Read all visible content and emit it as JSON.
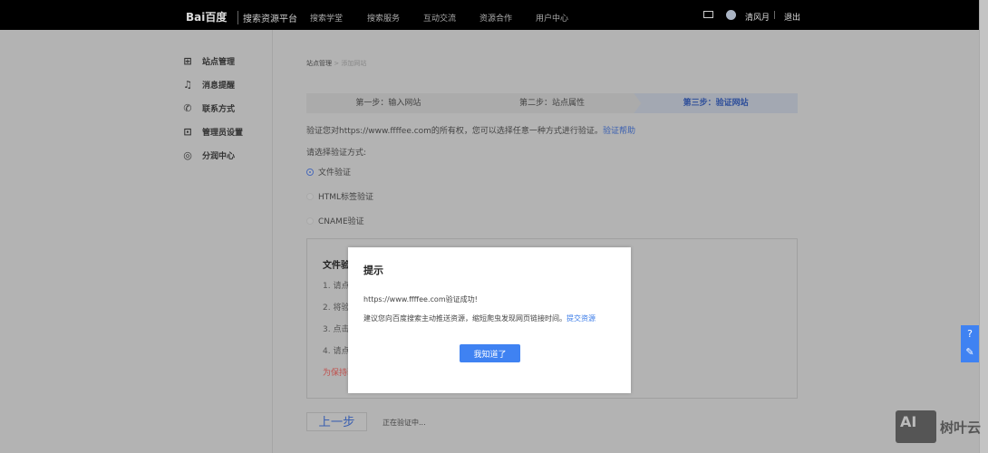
{
  "header": {
    "logo": "Bai百度",
    "platform": "搜索资源平台",
    "nav": [
      "搜索学堂",
      "搜索服务",
      "互动交流",
      "资源合作",
      "用户中心"
    ],
    "username": "清风月",
    "separator": "|",
    "logout": "退出"
  },
  "sidebar": {
    "items": [
      {
        "label": "站点管理",
        "icon": "sitemap-icon"
      },
      {
        "label": "消息提醒",
        "icon": "bell-icon"
      },
      {
        "label": "联系方式",
        "icon": "phone-icon"
      },
      {
        "label": "管理员设置",
        "icon": "admin-icon"
      },
      {
        "label": "分润中心",
        "icon": "revenue-icon"
      }
    ]
  },
  "breadcrumb": {
    "root": "站点管理",
    "sep": ">",
    "current": "添加网站"
  },
  "steps": [
    {
      "label": "第一步：输入网站"
    },
    {
      "label": "第二步：站点属性"
    },
    {
      "label": "第三步：验证网站",
      "active": true
    }
  ],
  "intro": {
    "text": "验证您对https://www.ffffee.com的所有权，您可以选择任意一种方式进行验证。",
    "link": "验证帮助"
  },
  "method_label": "请选择验证方式:",
  "methods": [
    {
      "label": "文件验证",
      "selected": true
    },
    {
      "label": "HTML标签验证",
      "selected": false
    },
    {
      "label": "CNAME验证",
      "selected": false
    }
  ],
  "file_box": {
    "title": "文件验",
    "lines": [
      "1. 请点",
      "2. 将验",
      "3. 点击",
      "4. 请点"
    ],
    "warning": "为保持验"
  },
  "footer": {
    "prev": "上一步",
    "status": "正在验证中..."
  },
  "modal": {
    "title": "提示",
    "line1": "https://www.ffffee.com验证成功!",
    "line2": "建议您向百度搜索主动推送资源，缩短爬虫发现网页链接时间。",
    "link": "提交资源",
    "ok": "我知道了"
  },
  "watermark": {
    "badge": "AI",
    "text": "树叶云"
  },
  "colors": {
    "accent": "#3f82f2",
    "link": "#3a5fb0",
    "warning": "#c0504d"
  }
}
